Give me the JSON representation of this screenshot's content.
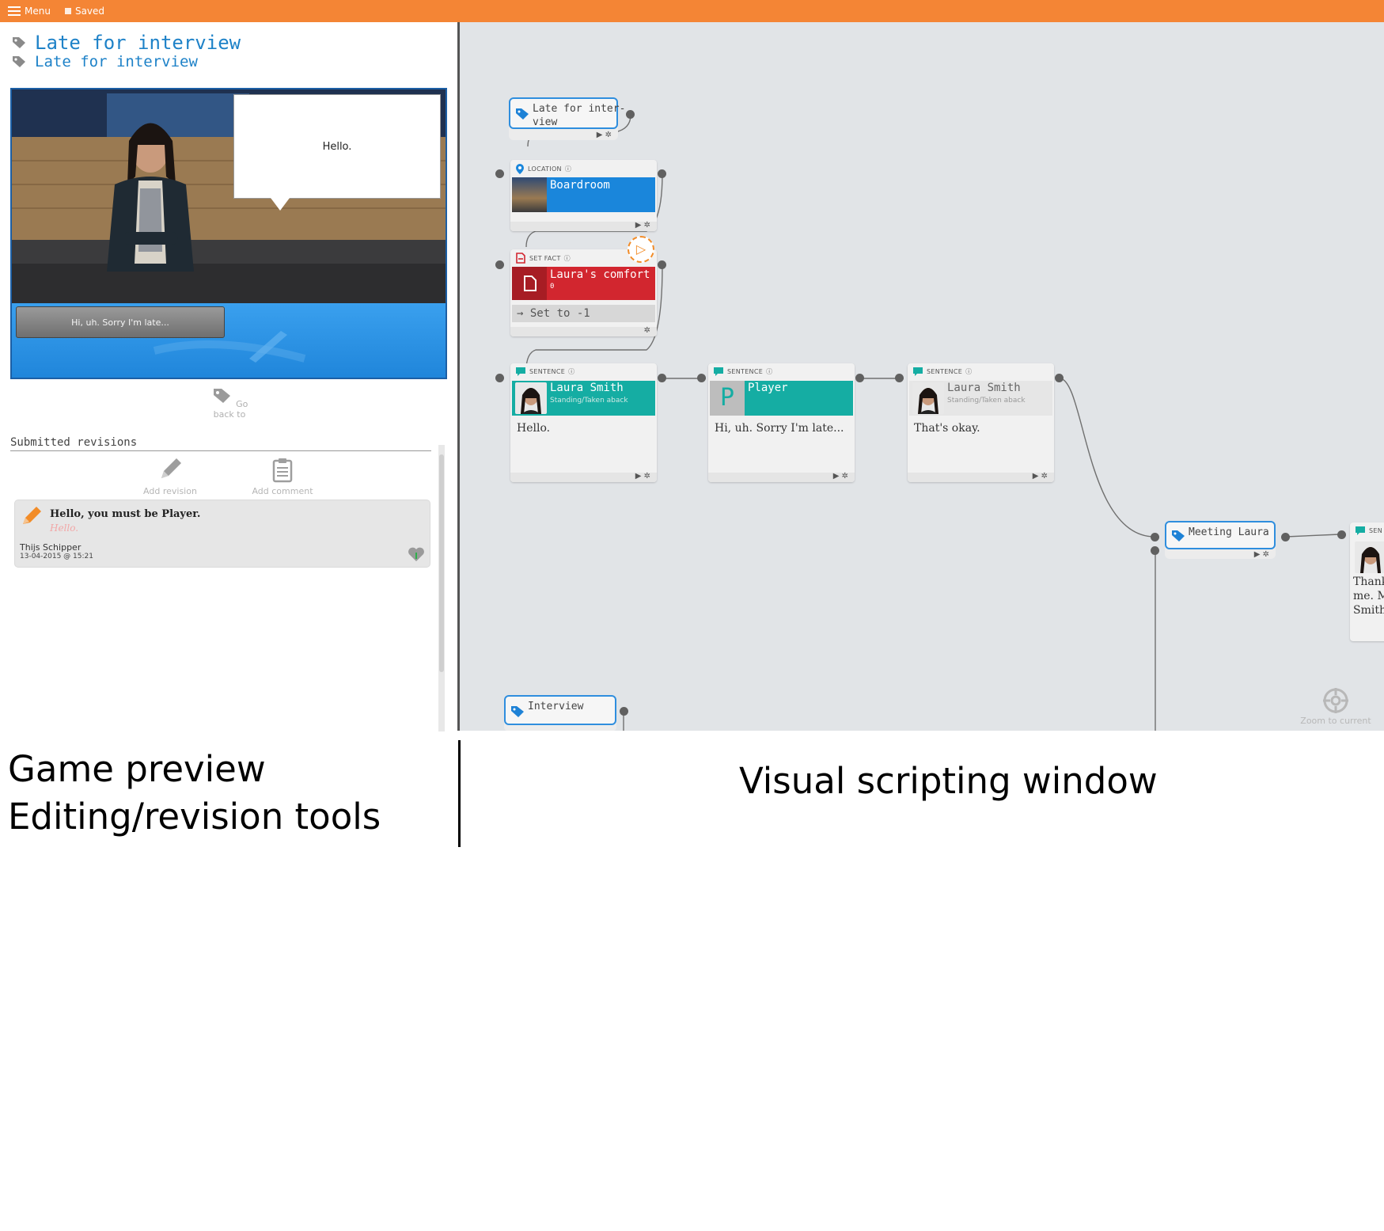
{
  "topbar": {
    "menu_label": "Menu",
    "saved_label": "Saved",
    "color": "#f48535"
  },
  "left": {
    "title_primary": "Late for interview",
    "title_secondary": "Late for interview",
    "preview": {
      "speech": "Hello.",
      "choice": "Hi, uh. Sorry I'm late..."
    },
    "go_back_label": "Go back to",
    "revisions": {
      "heading": "Submitted revisions",
      "add_revision_label": "Add revision",
      "add_comment_label": "Add comment",
      "items": [
        {
          "text": "Hello, you must be Player.",
          "original": "Hello.",
          "author": "Thijs Schipper",
          "date": "13-04-2015 @ 15:21"
        }
      ]
    }
  },
  "canvas": {
    "nodes": {
      "start_tag": {
        "label": "Late for inter-\nview"
      },
      "location": {
        "type": "LOCATION",
        "name": "Boardroom"
      },
      "set_fact": {
        "type": "SET FACT",
        "fact": "Laura's comfort",
        "value": "0",
        "operation": "Set to -1"
      },
      "sentence1": {
        "type": "SENTENCE",
        "speaker": "Laura Smith",
        "state": "Standing/Taken aback",
        "text": "Hello."
      },
      "sentence2": {
        "type": "SENTENCE",
        "speaker": "Player",
        "initial": "P",
        "text": "Hi, uh. Sorry I'm late..."
      },
      "sentence3": {
        "type": "SENTENCE",
        "speaker": "Laura Smith",
        "state": "Standing/Taken aback",
        "text": "That's okay."
      },
      "meeting_tag": {
        "label": "Meeting Laura"
      },
      "sentence4": {
        "type": "SEN",
        "text_lines": [
          "Thank",
          "me. M",
          "Smith"
        ]
      },
      "interview_tag": {
        "label": "Interview"
      }
    },
    "zoom_label": "Zoom to current",
    "colors": {
      "tag_border": "#2f8ede",
      "location": "#1a86db",
      "fact": "#d2262f",
      "speaker": "#15ada3"
    }
  },
  "captions": {
    "left_line1": "Game preview",
    "left_line2": "Editing/revision tools",
    "right": "Visual scripting window"
  }
}
